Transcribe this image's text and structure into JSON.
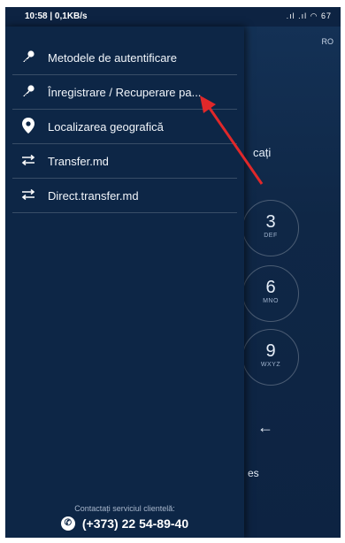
{
  "status_bar": {
    "time": "10:58 | 0,1KB/s",
    "icons": ".ıl .ıl ◠ 67"
  },
  "background": {
    "language": "RO",
    "partial_text": "cați",
    "partial_text_bottom": "es",
    "dial_keys": [
      {
        "digit": "3",
        "letters": "DEF"
      },
      {
        "digit": "6",
        "letters": "MNO"
      },
      {
        "digit": "9",
        "letters": "WXYZ"
      }
    ],
    "back_arrow": "←"
  },
  "drawer": {
    "menu_items": [
      {
        "label": "Metodele de autentificare",
        "icon": "key-icon"
      },
      {
        "label": "Înregistrare / Recuperare pa...",
        "icon": "key-icon"
      },
      {
        "label": "Localizarea geografică",
        "icon": "location-pin-icon"
      },
      {
        "label": "Transfer.md",
        "icon": "transfer-arrows-icon"
      },
      {
        "label": "Direct.transfer.md",
        "icon": "transfer-arrows-icon"
      }
    ],
    "footer": {
      "contact_label": "Contactați serviciul clientelă:",
      "phone": "(+373) 22 54-89-40"
    }
  },
  "annotation": {
    "arrow_color": "#e0282a"
  }
}
